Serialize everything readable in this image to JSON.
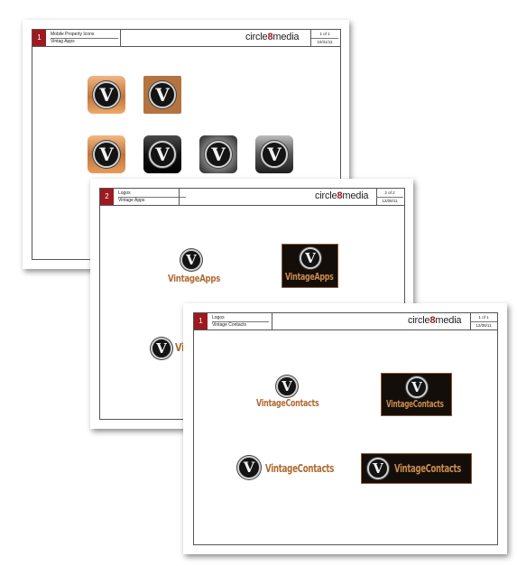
{
  "sheets": [
    {
      "page_number": "1",
      "title": "Mobile Property Icons",
      "subtitle": "Vintag Apps",
      "brand": {
        "pre": "circle",
        "num": "8",
        "post": "media"
      },
      "page_count": "1 of 1",
      "date": "10/31/11"
    },
    {
      "page_number": "2",
      "title": "Logos",
      "subtitle": "Vintage Apps",
      "brand": {
        "pre": "circle",
        "num": "8",
        "post": "media"
      },
      "page_count": "2 of 2",
      "date": "12/08/11",
      "logo_text": "VintageApps"
    },
    {
      "page_number": "1",
      "title": "Logos",
      "subtitle": "Vintage Contacts",
      "brand": {
        "pre": "circle",
        "num": "8",
        "post": "media"
      },
      "page_count": "1 of 1",
      "date": "12/08/11",
      "logo_text": "VintageContacts"
    }
  ],
  "emblem_letter": "V",
  "colors": {
    "accent_red": "#9c1a20",
    "copper": "#b06c34",
    "dark_logo_bg": "#140e0a"
  }
}
